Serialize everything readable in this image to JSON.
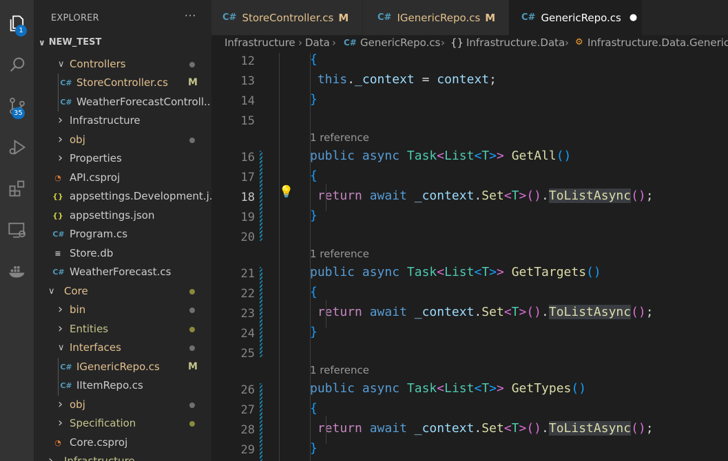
{
  "activity": {
    "explorer_badge": "1",
    "scm_badge": "35"
  },
  "explorer": {
    "title": "EXPLORER",
    "more": "···",
    "section": "NEW_TEST"
  },
  "tree": [
    {
      "label": "Controllers",
      "type": "folder",
      "open": true,
      "level": 1,
      "color": "#e2c08d",
      "dot": "grey"
    },
    {
      "label": "StoreController.cs",
      "type": "cs",
      "level": 2,
      "color": "#e2c08d",
      "status": "M"
    },
    {
      "label": "WeatherForecastControll...",
      "type": "cs",
      "level": 2,
      "color": "#cccccc"
    },
    {
      "label": "Infrastructure",
      "type": "folder",
      "open": false,
      "level": 1,
      "color": "#cccccc"
    },
    {
      "label": "obj",
      "type": "folder",
      "open": false,
      "level": 1,
      "color": "#e2c08d",
      "dot": "grey"
    },
    {
      "label": "Properties",
      "type": "folder",
      "open": false,
      "level": 1,
      "color": "#cccccc"
    },
    {
      "label": "API.csproj",
      "type": "rss",
      "level": 1,
      "color": "#cccccc"
    },
    {
      "label": "appsettings.Development.j...",
      "type": "json",
      "level": 1,
      "color": "#cccccc"
    },
    {
      "label": "appsettings.json",
      "type": "json",
      "level": 1,
      "color": "#cccccc"
    },
    {
      "label": "Program.cs",
      "type": "cs",
      "level": 1,
      "color": "#cccccc"
    },
    {
      "label": "Store.db",
      "type": "db",
      "level": 1,
      "color": "#cccccc"
    },
    {
      "label": "WeatherForecast.cs",
      "type": "cs",
      "level": 1,
      "color": "#cccccc"
    },
    {
      "label": "Core",
      "type": "folder",
      "open": true,
      "level": 0,
      "color": "#e2c08d",
      "dot": "yellow"
    },
    {
      "label": "bin",
      "type": "folder",
      "open": false,
      "level": 1,
      "color": "#e2c08d",
      "dot": "grey"
    },
    {
      "label": "Entities",
      "type": "folder",
      "open": false,
      "level": 1,
      "color": "#c4c48a",
      "dot": "yellow"
    },
    {
      "label": "Interfaces",
      "type": "folder",
      "open": true,
      "level": 1,
      "color": "#e2c08d",
      "dot": "grey"
    },
    {
      "label": "IGenericRepo.cs",
      "type": "cs",
      "level": 2,
      "color": "#e2c08d",
      "status": "M"
    },
    {
      "label": "IItemRepo.cs",
      "type": "cs",
      "level": 2,
      "color": "#cccccc"
    },
    {
      "label": "obj",
      "type": "folder",
      "open": false,
      "level": 1,
      "color": "#e2c08d",
      "dot": "grey"
    },
    {
      "label": "Specification",
      "type": "folder",
      "open": false,
      "level": 1,
      "color": "#c4c48a",
      "dot": "yellow"
    },
    {
      "label": "Core.csproj",
      "type": "rss",
      "level": 1,
      "color": "#cccccc"
    },
    {
      "label": "Infrastructure",
      "type": "folder",
      "open": false,
      "level": 0,
      "color": "#c4c48a"
    }
  ],
  "tabs": [
    {
      "label": "StoreController.cs",
      "status": "M",
      "color": "#e2c08d",
      "active": false
    },
    {
      "label": "IGenericRepo.cs",
      "status": "M",
      "color": "#e2c08d",
      "active": false
    },
    {
      "label": "GenericRepo.cs",
      "status": "●",
      "color": "#ffffff",
      "active": true
    }
  ],
  "breadcrumb": {
    "seg1": "Infrastructure",
    "seg2": "Data",
    "seg3": "GenericRepo.cs",
    "seg4_icon": "{}",
    "seg4": "Infrastructure.Data",
    "seg5": "Infrastructure.Data.GenericRe"
  },
  "editor": {
    "reference_lens": "1 reference",
    "current_line": "18",
    "lines": [
      {
        "n": "12"
      },
      {
        "n": "13"
      },
      {
        "n": "14"
      },
      {
        "n": "15"
      },
      {
        "n": "16"
      },
      {
        "n": "17"
      },
      {
        "n": "18"
      },
      {
        "n": "19"
      },
      {
        "n": "20"
      },
      {
        "n": "21"
      },
      {
        "n": "22"
      },
      {
        "n": "23"
      },
      {
        "n": "24"
      },
      {
        "n": "25"
      },
      {
        "n": "26"
      },
      {
        "n": "27"
      },
      {
        "n": "28"
      },
      {
        "n": "29"
      }
    ],
    "methods": [
      "GetAll",
      "GetTargets",
      "GetTypes"
    ]
  },
  "colors": {
    "accent": "#0e70c0",
    "modified": "#e2c08d",
    "activity_bg": "#333333",
    "sidebar_bg": "#252526",
    "editor_bg": "#1e1e1e"
  }
}
